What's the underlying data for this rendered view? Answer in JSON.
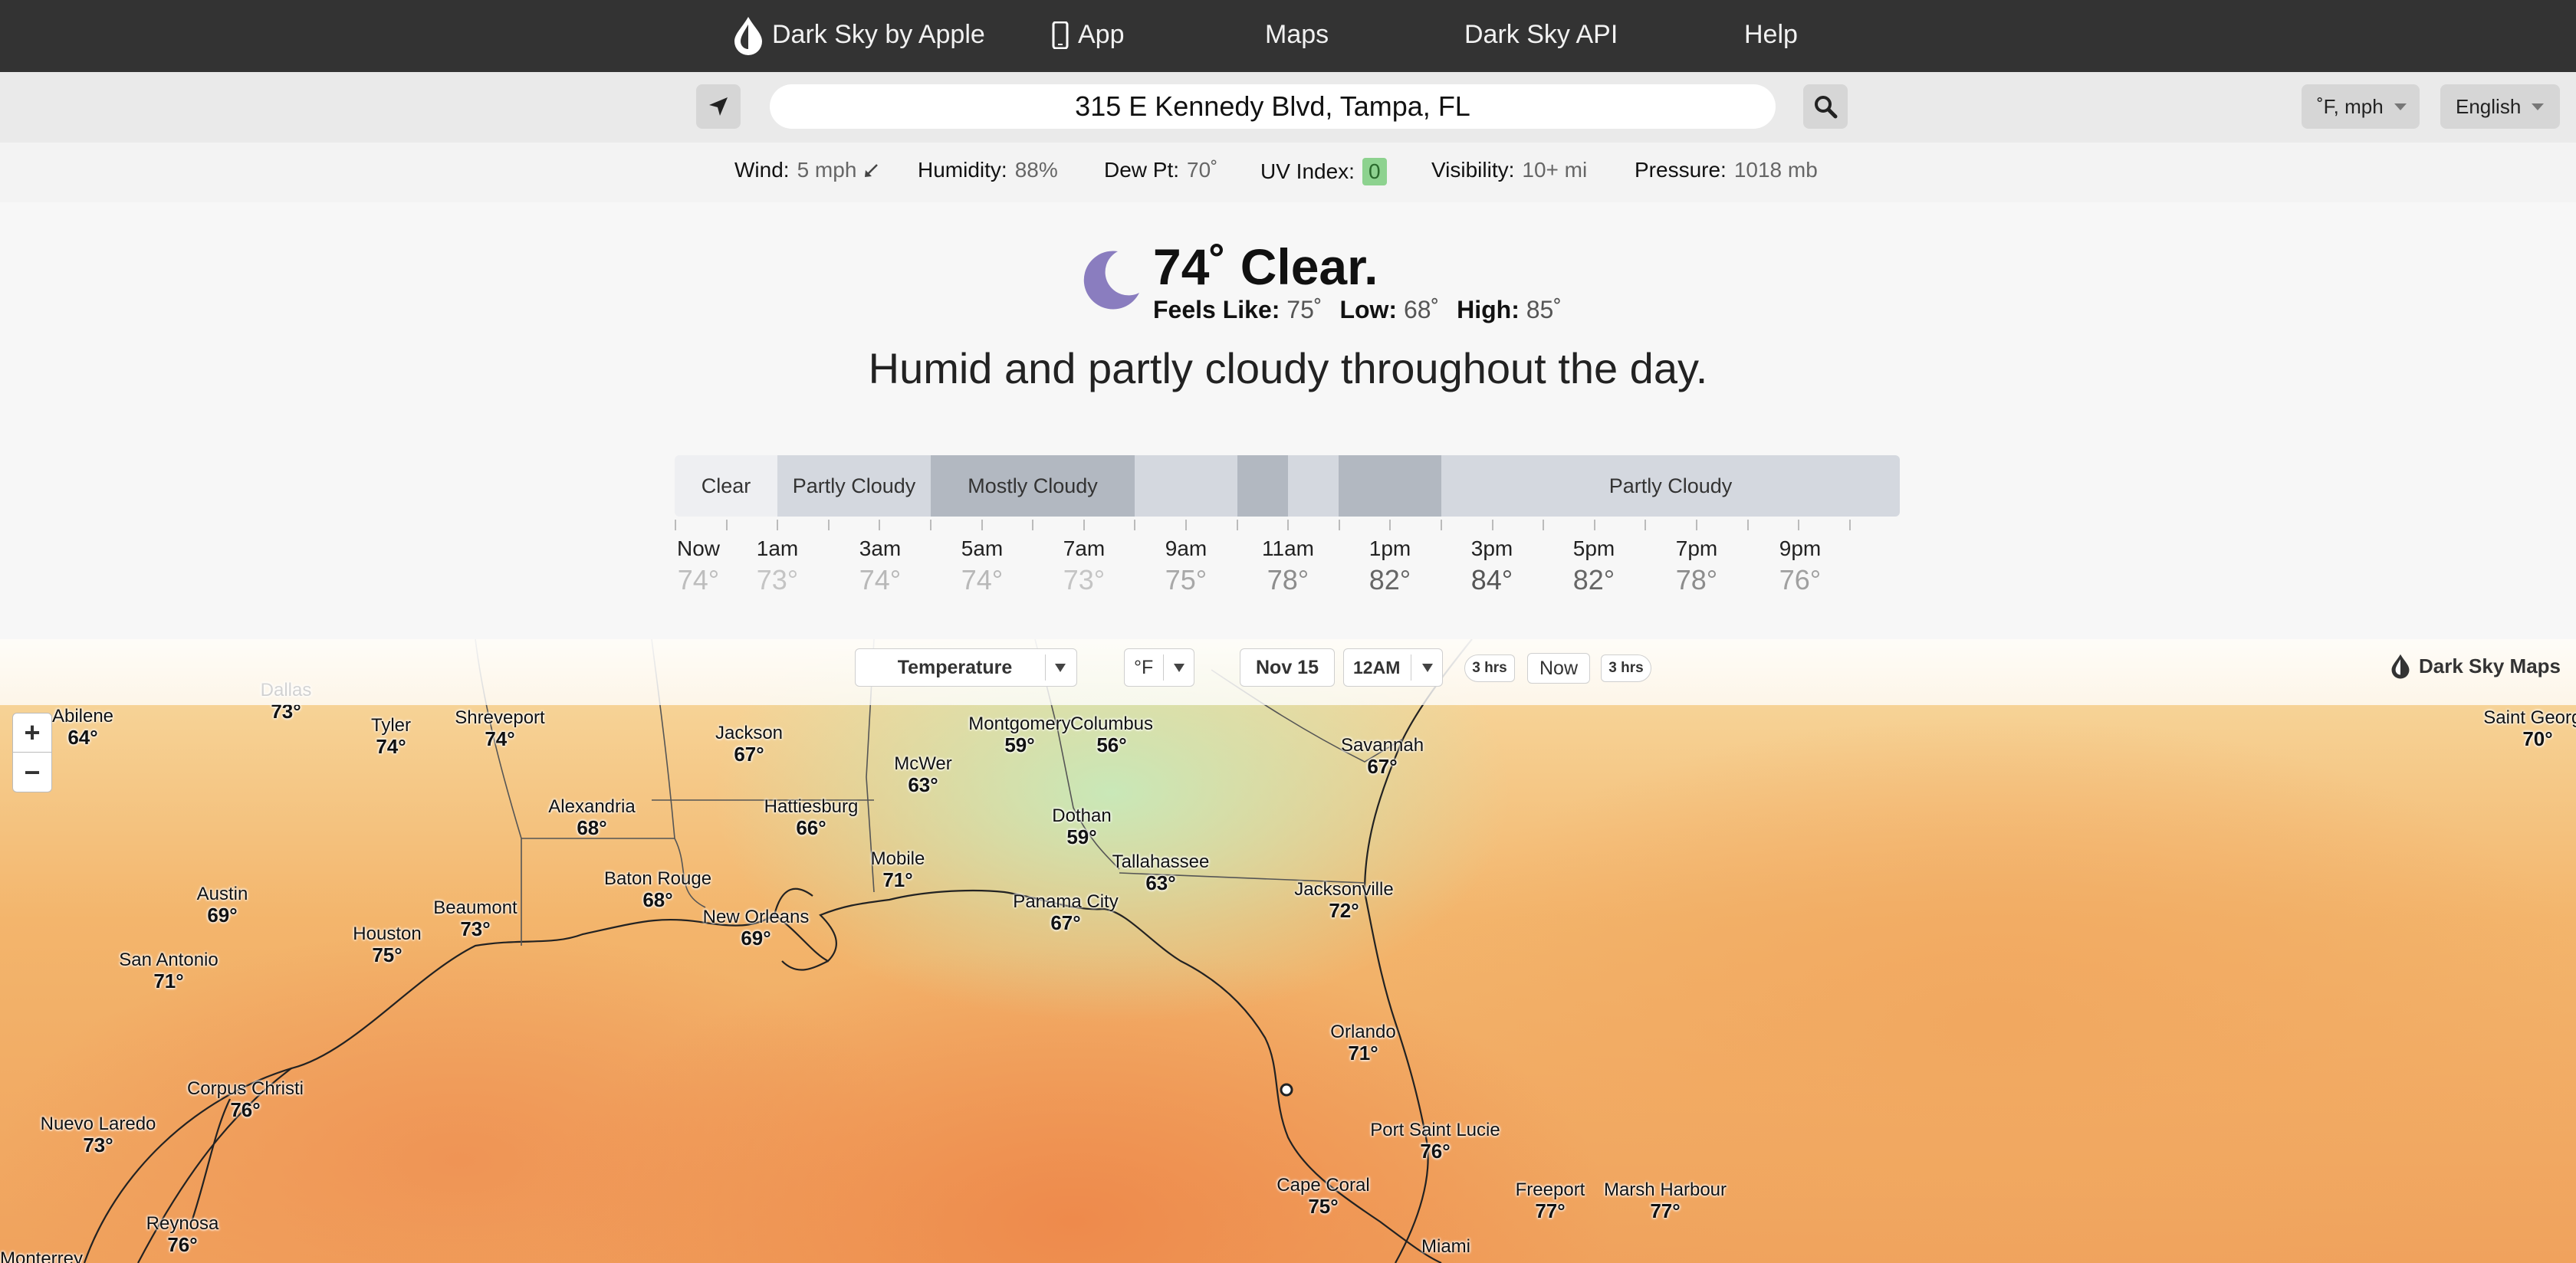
{
  "nav": {
    "brand": "Dark Sky by Apple",
    "app": "App",
    "maps": "Maps",
    "api": "Dark Sky API",
    "help": "Help"
  },
  "search": {
    "value": "315 E Kennedy Blvd, Tampa, FL",
    "units": "˚F, mph",
    "language": "English"
  },
  "conditions": {
    "wind_label": "Wind:",
    "wind_value": "5 mph",
    "humidity_label": "Humidity:",
    "humidity_value": "88%",
    "dewpt_label": "Dew Pt:",
    "dewpt_value": "70˚",
    "uv_label": "UV Index:",
    "uv_value": "0",
    "visibility_label": "Visibility:",
    "visibility_value": "10+ mi",
    "pressure_label": "Pressure:",
    "pressure_value": "1018 mb",
    "uv_color": "#8dd28f"
  },
  "current": {
    "title": "74˚ Clear.",
    "feels_label": "Feels Like:",
    "feels_value": "75˚",
    "low_label": "Low:",
    "low_value": "68˚",
    "high_label": "High:",
    "high_value": "85˚",
    "summary": "Humid and partly cloudy throughout the day.",
    "icon": "moon-icon"
  },
  "timeline": {
    "segments": [
      {
        "label": "Clear",
        "color": "#eeeff2"
      },
      {
        "label": "Partly Cloudy",
        "color": "#d4d8df"
      },
      {
        "label": "Mostly Cloudy",
        "color": "#b2b8c1"
      },
      {
        "label": "",
        "color": "#d4d8df"
      },
      {
        "label": "",
        "color": "#b2b8c1"
      },
      {
        "label": "",
        "color": "#d4d8df"
      },
      {
        "label": "",
        "color": "#b2b8c1"
      },
      {
        "label": "Partly Cloudy",
        "color": "#d4d8df"
      }
    ],
    "hours": [
      {
        "label": "Now",
        "temp": "74°"
      },
      {
        "label": "1am",
        "temp": "73°"
      },
      {
        "label": "3am",
        "temp": "74°"
      },
      {
        "label": "5am",
        "temp": "74°"
      },
      {
        "label": "7am",
        "temp": "73°"
      },
      {
        "label": "9am",
        "temp": "75°"
      },
      {
        "label": "11am",
        "temp": "78°"
      },
      {
        "label": "1pm",
        "temp": "82°"
      },
      {
        "label": "3pm",
        "temp": "84°"
      },
      {
        "label": "5pm",
        "temp": "82°"
      },
      {
        "label": "7pm",
        "temp": "78°"
      },
      {
        "label": "9pm",
        "temp": "76°"
      }
    ]
  },
  "map": {
    "layer": "Temperature",
    "unit": "°F",
    "date": "Nov 15",
    "time": "12AM",
    "back_step": "3 hrs",
    "now": "Now",
    "forward_step": "3 hrs",
    "brand": "Dark Sky Maps",
    "zoom_in": "+",
    "zoom_out": "−",
    "cities": [
      {
        "name": "Dallas",
        "temp": "73°"
      },
      {
        "name": "Abilene",
        "temp": "64°"
      },
      {
        "name": "Tyler",
        "temp": "74°"
      },
      {
        "name": "Shreveport",
        "temp": "74°"
      },
      {
        "name": "Jackson",
        "temp": "67°"
      },
      {
        "name": "Montgomery",
        "temp": "59°"
      },
      {
        "name": "Columbus",
        "temp": "56°"
      },
      {
        "name": "Savannah",
        "temp": "67°"
      },
      {
        "name": "Saint George",
        "temp": "70°"
      },
      {
        "name": "McWer",
        "temp": "63°"
      },
      {
        "name": "Alexandria",
        "temp": "68°"
      },
      {
        "name": "Hattiesburg",
        "temp": "66°"
      },
      {
        "name": "Dothan",
        "temp": "59°"
      },
      {
        "name": "Mobile",
        "temp": "71°"
      },
      {
        "name": "Tallahassee",
        "temp": "63°"
      },
      {
        "name": "Jacksonville",
        "temp": "72°"
      },
      {
        "name": "Austin",
        "temp": "69°"
      },
      {
        "name": "Baton Rouge",
        "temp": "68°"
      },
      {
        "name": "Panama City",
        "temp": "67°"
      },
      {
        "name": "Beaumont",
        "temp": "73°"
      },
      {
        "name": "New Orleans",
        "temp": "69°"
      },
      {
        "name": "Houston",
        "temp": "75°"
      },
      {
        "name": "San Antonio",
        "temp": "71°"
      },
      {
        "name": "Orlando",
        "temp": "71°"
      },
      {
        "name": "Corpus Christi",
        "temp": "76°"
      },
      {
        "name": "Nuevo Laredo",
        "temp": "73°"
      },
      {
        "name": "Port Saint Lucie",
        "temp": "76°"
      },
      {
        "name": "Cape Coral",
        "temp": "75°"
      },
      {
        "name": "Freeport",
        "temp": "77°"
      },
      {
        "name": "Marsh Harbour",
        "temp": "77°"
      },
      {
        "name": "Reynosa",
        "temp": "76°"
      },
      {
        "name": "Miami",
        "temp": ""
      },
      {
        "name": "Monterrey",
        "temp": ""
      }
    ]
  }
}
